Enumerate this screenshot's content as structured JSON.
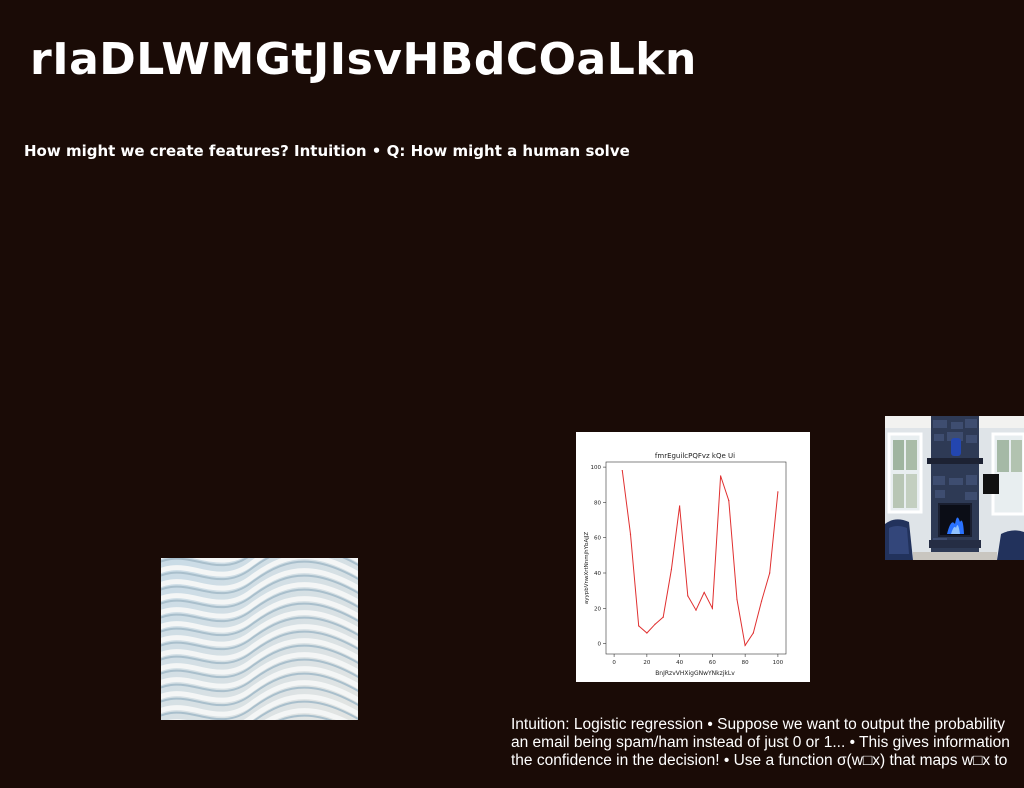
{
  "slide": {
    "title": "rIaDLWMGtJIsvHBdCOaLkn",
    "subtitle": "How might we create features? Intuition • Q: How might a human solve",
    "body_lines": [
      "Intuition: Logistic regression • Suppose we want to output the probability",
      "an email being spam/ham instead of just 0 or 1... • This gives information",
      "the confidence in the decision! • Use a function σ(w□x) that maps w□x to"
    ]
  },
  "images": {
    "waves": "abstract-waves-image",
    "room": "living-room-fireplace-image"
  },
  "colors": {
    "background": "#1a0b06",
    "text": "#ffffff",
    "line": "#e03030"
  },
  "chart_data": {
    "type": "line",
    "title": "fmrEguilcPQFvz kQe Ui",
    "xlabel": "BnJRzvVHXigGNwYNkzjkLv",
    "ylabel": "ayypbVnwXrtNnmjhYbAjJZ",
    "xlim": [
      0,
      100
    ],
    "ylim": [
      0,
      100
    ],
    "x_ticks": [
      0,
      20,
      40,
      60,
      80,
      100
    ],
    "y_ticks": [
      0,
      20,
      40,
      60,
      80,
      100
    ],
    "x": [
      5,
      10,
      15,
      20,
      25,
      30,
      35,
      40,
      45,
      50,
      55,
      60,
      65,
      70,
      75,
      80,
      85,
      90,
      95,
      100
    ],
    "series": [
      {
        "values": [
          98,
          62,
          10,
          6,
          11,
          15,
          42,
          78,
          27,
          19,
          29,
          20,
          95,
          81,
          25,
          -1,
          6,
          24,
          40,
          86
        ]
      }
    ],
    "grid": false
  }
}
